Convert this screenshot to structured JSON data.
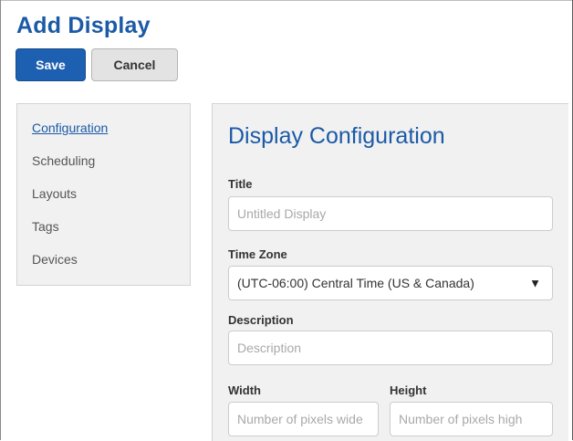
{
  "header": {
    "title": "Add Display",
    "save_label": "Save",
    "cancel_label": "Cancel"
  },
  "sidebar": {
    "items": [
      {
        "label": "Configuration",
        "active": true
      },
      {
        "label": "Scheduling",
        "active": false
      },
      {
        "label": "Layouts",
        "active": false
      },
      {
        "label": "Tags",
        "active": false
      },
      {
        "label": "Devices",
        "active": false
      }
    ]
  },
  "form": {
    "section_title": "Display Configuration",
    "title": {
      "label": "Title",
      "value": "",
      "placeholder": "Untitled Display"
    },
    "time_zone": {
      "label": "Time Zone",
      "value": "(UTC-06:00) Central Time (US & Canada)",
      "arrow_icon": "dropdown-arrow-icon"
    },
    "description": {
      "label": "Description",
      "value": "",
      "placeholder": "Description"
    },
    "width": {
      "label": "Width",
      "value": "",
      "placeholder": "Number of pixels wide"
    },
    "height": {
      "label": "Height",
      "value": "",
      "placeholder": "Number of pixels high"
    }
  },
  "colors": {
    "accent": "#1b5aa6",
    "save_button": "#1d5fb0",
    "panel_background": "#f1f1f1"
  }
}
